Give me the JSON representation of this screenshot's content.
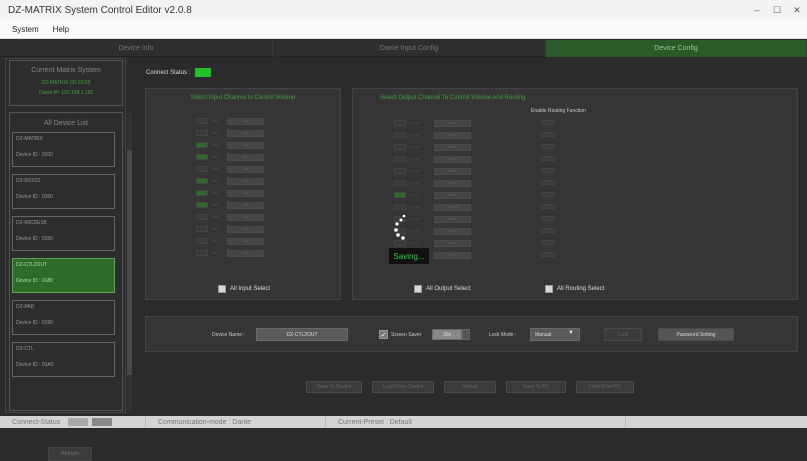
{
  "window": {
    "title": "DZ-MATRIX System Control Editor v2.0.8",
    "minimize": "–",
    "maximize": "☐",
    "close": "✕"
  },
  "menu": [
    "System",
    "Help"
  ],
  "tabs": [
    {
      "label": "Device Info",
      "active": false
    },
    {
      "label": "Dante Input Config",
      "active": false
    },
    {
      "label": "Device Config",
      "active": true
    }
  ],
  "current_system": {
    "title": "Current Matrix System",
    "device": "DZ-MATRIX (ID:0100)",
    "ip": "Dante IP: 192.168.1.110"
  },
  "device_list": {
    "header": "All Device List",
    "devices": [
      {
        "name": "DZ-MATRIX",
        "id": "Device ID : 0100",
        "active": false
      },
      {
        "name": "DZ-BOX22",
        "id": "Device ID : 0160",
        "active": false
      },
      {
        "name": "DZ-MICDESK",
        "id": "Device ID : 0150",
        "active": false
      },
      {
        "name": "DZ-CTL2OUT",
        "id": "Device ID : 0180",
        "active": true
      },
      {
        "name": "DZ-PAD",
        "id": "Device ID : 0190",
        "active": false
      },
      {
        "name": "DZ-CTL",
        "id": "Device ID : 01A0",
        "active": false
      }
    ],
    "refresh": "Refresh"
  },
  "connect_status_label": "Connect Status :",
  "input_panel": {
    "title": "Select Input Channel to Control Volume",
    "select_all": "All Input Select",
    "channels": [
      {
        "label": "IN01",
        "name": "IN01",
        "on": false
      },
      {
        "label": "IN02",
        "name": "IN02",
        "on": false
      },
      {
        "label": "IN03",
        "name": "IN03",
        "on": true
      },
      {
        "label": "IN04",
        "name": "IN04",
        "on": true
      },
      {
        "label": "IN05",
        "name": "IN05",
        "on": false
      },
      {
        "label": "IN06",
        "name": "IN06",
        "on": true
      },
      {
        "label": "IN07",
        "name": "IN07",
        "on": true
      },
      {
        "label": "IN08",
        "name": "IN08",
        "on": true
      },
      {
        "label": "IN09",
        "name": "IN09",
        "on": false
      },
      {
        "label": "IN10",
        "name": "IN10",
        "on": false
      },
      {
        "label": "IN11",
        "name": "IN11",
        "on": false
      },
      {
        "label": "IN12",
        "name": "IN12",
        "on": false
      }
    ]
  },
  "output_panel": {
    "title": "Select Output Channel To Control Volume And Routing",
    "routing_title": "Enable Routing Function",
    "select_all": "All Output Select",
    "routing_select_all": "All Routing Select",
    "channels": [
      {
        "label": "OUT01",
        "name": "OUT01",
        "on": false
      },
      {
        "label": "OUT02",
        "name": "OUT02",
        "on": false
      },
      {
        "label": "OUT03",
        "name": "OUT03",
        "on": false
      },
      {
        "label": "OUT04",
        "name": "OUT04",
        "on": false
      },
      {
        "label": "OUT05",
        "name": "OUT05",
        "on": false
      },
      {
        "label": "OUT06",
        "name": "OUT06",
        "on": false
      },
      {
        "label": "OUT07",
        "name": "OUT07",
        "on": true
      },
      {
        "label": "OUT08",
        "name": "OUT08",
        "on": false
      },
      {
        "label": "OUT09",
        "name": "OUT09",
        "on": false
      },
      {
        "label": "OUT10",
        "name": "OUT10",
        "on": false
      },
      {
        "label": "OUT11",
        "name": "OUT11",
        "on": false
      },
      {
        "label": "OUT12",
        "name": "OUT12",
        "on": false
      }
    ],
    "saving": "Saving..."
  },
  "device_bar": {
    "device_name_label": "Device Name :",
    "device_name_value": "DZ-CTL2OUT",
    "screen_saver_label": "Screen Saver",
    "screen_saver_value": "30s",
    "lock_mode_label": "Lock Mode :",
    "lock_mode_value": "Manual",
    "lock_button": "Lock",
    "password_button": "Password Setting"
  },
  "actions": [
    "Save To Device",
    "Load From Device",
    "Default",
    "Save To PC",
    "Load From PC"
  ],
  "statusbar": {
    "connect": "Connect-Status",
    "mode": "Communication-mode : Dante",
    "preset": "Current-Preset : Default"
  },
  "colors": {
    "accent_green": "#3fa33b",
    "led_green": "#22c02a",
    "active_bg": "#2e6b29"
  }
}
